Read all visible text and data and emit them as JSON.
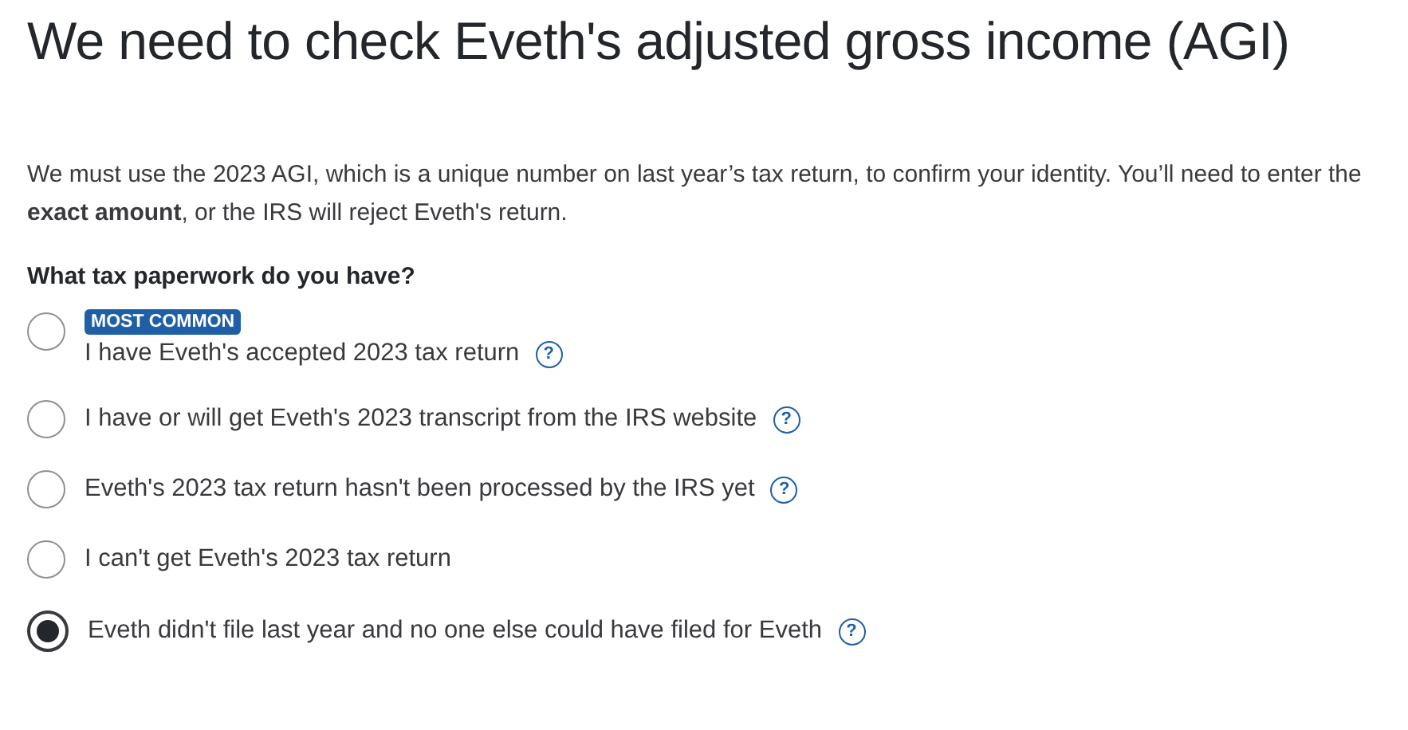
{
  "title": "We need to check Eveth's adjusted gross income (AGI)",
  "intro": "We must use the 2023 AGI, which is a unique number on last year’s tax return, to confirm your identity. You’ll need to enter the **exact amount**, or the IRS will reject Eveth's return.",
  "question": "What tax paperwork do you have?",
  "options": [
    {
      "badge": "MOST COMMON",
      "label": "I have Eveth's accepted 2023 tax return",
      "help": "?",
      "selected": false
    },
    {
      "label": "I have or will get Eveth's 2023 transcript from the IRS website",
      "help": "?",
      "selected": false
    },
    {
      "label": "Eveth's 2023 tax return hasn't been processed by the IRS yet",
      "help": "?",
      "selected": false
    },
    {
      "label": "I can't get Eveth's 2023 tax return",
      "selected": false
    },
    {
      "label": "Eveth didn't file last year and no one else could have filed for Eveth",
      "help": "?",
      "selected": true
    }
  ]
}
